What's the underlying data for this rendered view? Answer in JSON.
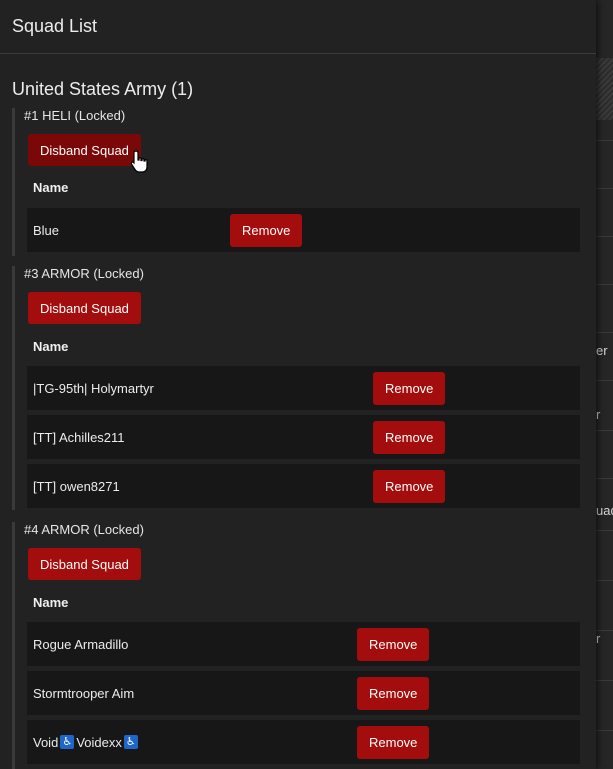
{
  "background": {
    "fragments": [
      "er",
      "r",
      "uad",
      "r"
    ]
  },
  "modal": {
    "title": "Squad List",
    "faction": "United States Army (1)",
    "squads": [
      {
        "title": "#1 HELI (Locked)",
        "disband_label": "Disband Squad",
        "name_header": "Name",
        "members": [
          {
            "name": "Blue",
            "remove_label": "Remove"
          }
        ]
      },
      {
        "title": "#3 ARMOR (Locked)",
        "disband_label": "Disband Squad",
        "name_header": "Name",
        "members": [
          {
            "name": "|TG-95th| Holymartyr",
            "remove_label": "Remove"
          },
          {
            "name": "[TT] Achilles211",
            "remove_label": "Remove"
          },
          {
            "name": "[TT] owen8271",
            "remove_label": "Remove"
          }
        ]
      },
      {
        "title": "#4 ARMOR (Locked)",
        "disband_label": "Disband Squad",
        "name_header": "Name",
        "members": [
          {
            "name": "Rogue Armadillo",
            "remove_label": "Remove"
          },
          {
            "name": "Stormtrooper Aim",
            "remove_label": "Remove"
          },
          {
            "name_parts": [
              "Void",
              "♿",
              "Voidexx",
              "♿"
            ],
            "remove_label": "Remove"
          }
        ]
      }
    ]
  },
  "colors": {
    "danger": "#a30d0d",
    "danger_hover": "#7a0808",
    "modal_bg": "#222222",
    "row_bg": "#171717",
    "accessibility_badge": "#1f66c9"
  }
}
